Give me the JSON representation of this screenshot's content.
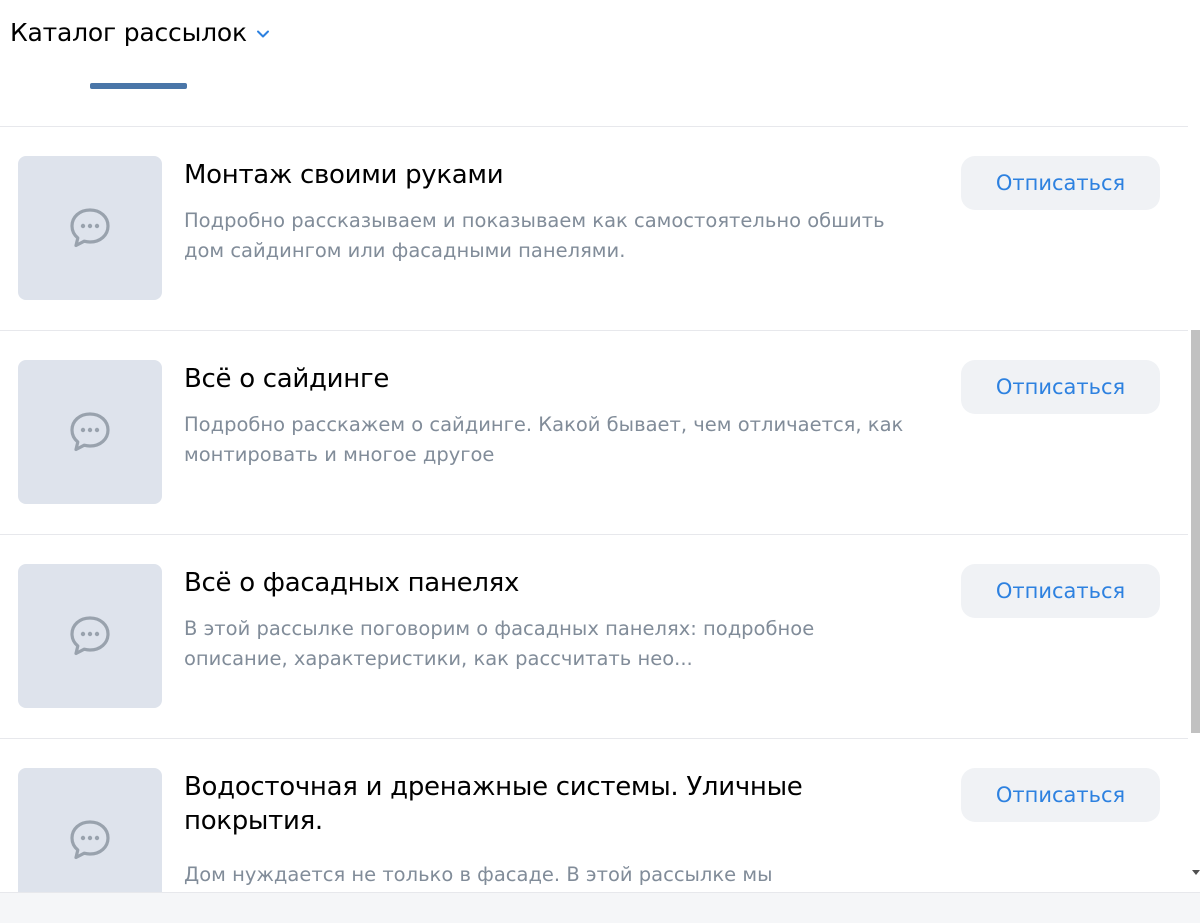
{
  "header": {
    "title": "Каталог рассылок"
  },
  "colors": {
    "accent": "#2d81e0",
    "tab_indicator": "#4a76a8",
    "thumb_bg": "#dee3ec",
    "button_bg": "#f0f2f5",
    "description": "#818c99"
  },
  "icons": {
    "thumbnail": "chat-bubble-icon",
    "header_dropdown": "chevron-down-icon"
  },
  "subscriptions": [
    {
      "title": "Монтаж своими руками",
      "description": "Подробно рассказываем и показываем как самостоятельно обшить дом сайдингом или фасадными панелями.",
      "button": "Отписаться"
    },
    {
      "title": "Всё о сайдинге",
      "description": "Подробно расскажем о сайдинге. Какой бывает, чем отличается, как монтировать и многое другое",
      "button": "Отписаться"
    },
    {
      "title": "Всё о фасадных панелях",
      "description": "В этой рассылке поговорим о фасадных панелях: подробное описание, характеристики, как рассчитать нео...",
      "button": "Отписаться"
    },
    {
      "title": "Водосточная и дренажные системы. Уличные покрытия.",
      "description": "Дом нуждается не только в фасаде. В этой рассылке мы",
      "button": "Отписаться"
    }
  ]
}
